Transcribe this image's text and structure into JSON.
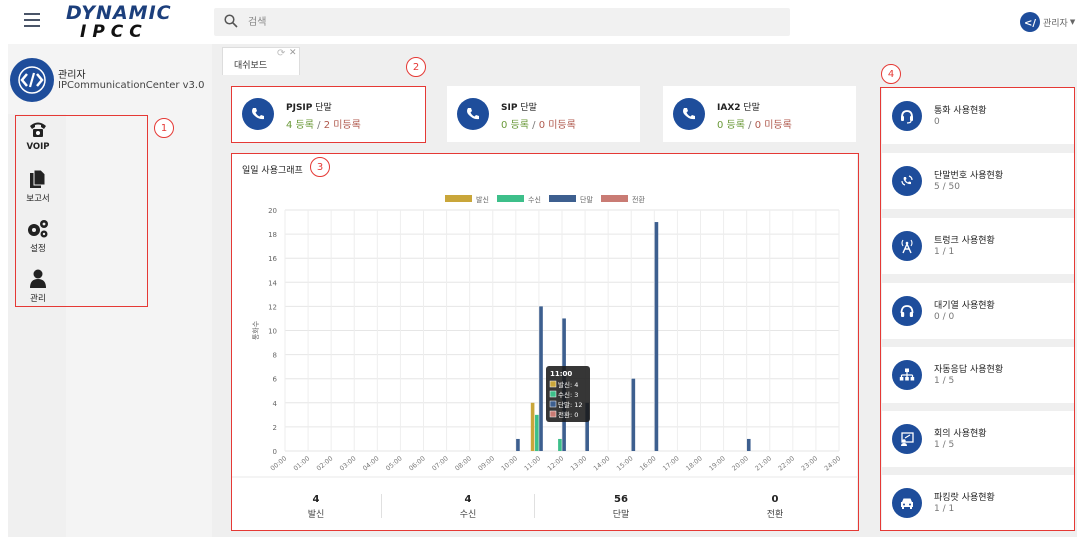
{
  "app": {
    "logo_line1": "DYNAMIC",
    "logo_line2": "IPCC"
  },
  "search": {
    "placeholder": "검색"
  },
  "user": {
    "name": "관리자"
  },
  "profile": {
    "name": "관리자",
    "version": "IPCommunicationCenter v3.0"
  },
  "nav": [
    {
      "label": "VOIP",
      "icon": "phone-icon"
    },
    {
      "label": "보고서",
      "icon": "documents-icon"
    },
    {
      "label": "설정",
      "icon": "gears-icon"
    },
    {
      "label": "관리",
      "icon": "user-icon"
    }
  ],
  "tabs": [
    {
      "label": "대쉬보드"
    }
  ],
  "annotations": [
    "1",
    "2",
    "3",
    "4"
  ],
  "extensions": [
    {
      "name": "PJSIP",
      "suffix": "단말",
      "registered": "4 등록",
      "sep": " / ",
      "unregistered": "2 미등록"
    },
    {
      "name": "SIP",
      "suffix": "단말",
      "registered": "0 등록",
      "sep": " / ",
      "unregistered": "0 미등록"
    },
    {
      "name": "IAX2",
      "suffix": "단말",
      "registered": "0 등록",
      "sep": " / ",
      "unregistered": "0 미등록"
    }
  ],
  "graph": {
    "title": "일일 사용그래프",
    "tooltip": {
      "title": "11:00",
      "lines": [
        "발신: 4",
        "수신: 3",
        "단말: 12",
        "전환: 0"
      ]
    }
  },
  "chart_data": {
    "type": "bar",
    "title": "일일 사용그래프",
    "ylabel": "통화수",
    "xlabel": "",
    "ylim": [
      0,
      20
    ],
    "yticks": [
      0,
      2,
      4,
      6,
      8,
      10,
      12,
      14,
      16,
      18,
      20
    ],
    "grid": true,
    "legend_position": "top",
    "categories": [
      "00:00",
      "01:00",
      "02:00",
      "03:00",
      "04:00",
      "05:00",
      "06:00",
      "07:00",
      "08:00",
      "09:00",
      "10:00",
      "11:00",
      "12:00",
      "13:00",
      "14:00",
      "15:00",
      "16:00",
      "17:00",
      "18:00",
      "19:00",
      "20:00",
      "21:00",
      "22:00",
      "23:00",
      "24:00"
    ],
    "series": [
      {
        "name": "발신",
        "color": "#c9a63a",
        "values": [
          0,
          0,
          0,
          0,
          0,
          0,
          0,
          0,
          0,
          0,
          0,
          4,
          0,
          0,
          0,
          0,
          0,
          0,
          0,
          0,
          0,
          0,
          0,
          0,
          0
        ]
      },
      {
        "name": "수신",
        "color": "#3dbf8a",
        "values": [
          0,
          0,
          0,
          0,
          0,
          0,
          0,
          0,
          0,
          0,
          0,
          3,
          1,
          0,
          0,
          0,
          0,
          0,
          0,
          0,
          0,
          0,
          0,
          0,
          0
        ]
      },
      {
        "name": "단말",
        "color": "#3d5f8f",
        "values": [
          0,
          0,
          0,
          0,
          0,
          0,
          0,
          0,
          0,
          0,
          1,
          12,
          11,
          4,
          0,
          6,
          19,
          0,
          0,
          0,
          1,
          0,
          0,
          0,
          0
        ]
      },
      {
        "name": "전환",
        "color": "#c97b74",
        "values": [
          0,
          0,
          0,
          0,
          0,
          0,
          0,
          0,
          0,
          0,
          0,
          0,
          0,
          0,
          0,
          0,
          0,
          0,
          0,
          0,
          0,
          0,
          0,
          0,
          0
        ]
      }
    ]
  },
  "stats": [
    {
      "value": "4",
      "label": "발신"
    },
    {
      "value": "4",
      "label": "수신"
    },
    {
      "value": "56",
      "label": "단말"
    },
    {
      "value": "0",
      "label": "전환"
    }
  ],
  "right_cards": [
    {
      "title": "통화 사용현황",
      "value": "0",
      "icon": "headset-icon"
    },
    {
      "title": "단말번호 사용현황",
      "value": "5 / 50",
      "icon": "phone-waves-icon"
    },
    {
      "title": "트렁크 사용현황",
      "value": "1 / 1",
      "icon": "antenna-icon"
    },
    {
      "title": "대기열 사용현황",
      "value": "0 / 0",
      "icon": "headphones-icon"
    },
    {
      "title": "자동응답 사용현황",
      "value": "1 / 5",
      "icon": "sitemap-icon"
    },
    {
      "title": "회의 사용현황",
      "value": "1 / 5",
      "icon": "conference-icon"
    },
    {
      "title": "파킹랏 사용현황",
      "value": "1 / 1",
      "icon": "car-icon"
    }
  ]
}
